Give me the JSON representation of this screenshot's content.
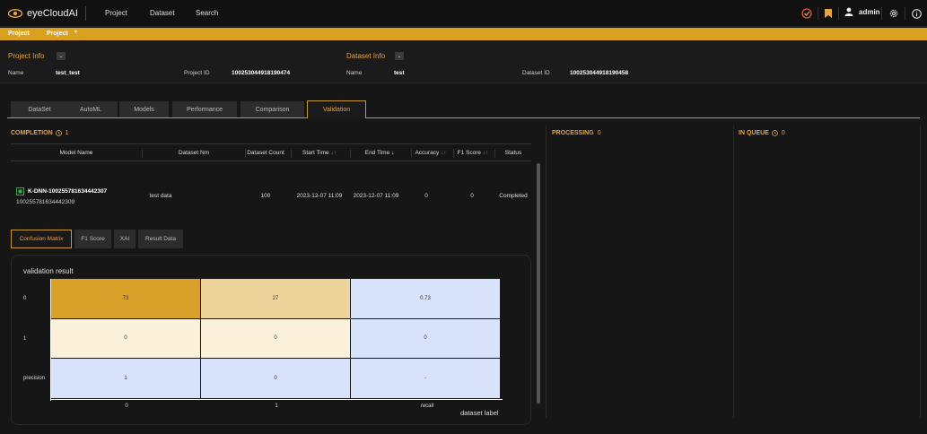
{
  "app": {
    "name": "eyeCloudAI"
  },
  "topnav": [
    "Project",
    "Dataset",
    "Search"
  ],
  "user": {
    "name": "admin"
  },
  "breadcrumb": {
    "root": "Project",
    "current": "Project"
  },
  "project_info": {
    "title": "Project Info",
    "name_label": "Name",
    "name": "test_test",
    "id_label": "Project ID",
    "id": "100253044918190474"
  },
  "dataset_info": {
    "title": "Dataset Info",
    "name_label": "Name",
    "name": "test",
    "id_label": "Dataset ID",
    "id": "100253044918190458"
  },
  "tabs": [
    "DataSet",
    "AutoML",
    "Models",
    "Performance",
    "Comparison",
    "Validation"
  ],
  "active_tab": "Validation",
  "completion": {
    "title": "COMPLETION",
    "count": "1"
  },
  "processing": {
    "title": "PROCESSING",
    "count": "0"
  },
  "in_queue": {
    "title": "IN QUEUE",
    "count": "0"
  },
  "table": {
    "headers": [
      "Model Name",
      "Dataset Nm",
      "Dataset Count",
      "Start Time",
      "End Time",
      "Accuracy",
      "F1 Score",
      "Status"
    ],
    "rows": [
      {
        "model_name": "K-DNN-100255781634442307",
        "model_id": "100255781634442309",
        "dataset_nm": "test data",
        "dataset_count": "100",
        "start_time": "2023-12-07 11:09",
        "end_time": "2023-12-07 11:09",
        "accuracy": "0",
        "f1_score": "0",
        "status": "Completed"
      }
    ]
  },
  "subtabs": [
    "Confusion Matrix",
    "F1 Score",
    "XAI",
    "Result Data"
  ],
  "active_subtab": "Confusion Matrix",
  "matrix": {
    "title": "validation result",
    "xlabel": "dataset label",
    "row_labels": [
      "0",
      "1",
      "precision"
    ],
    "col_labels": [
      "0",
      "1",
      "recall"
    ],
    "cells": [
      [
        "73",
        "27",
        "0.73"
      ],
      [
        "0",
        "0",
        "0"
      ],
      [
        "1",
        "0",
        "-"
      ]
    ],
    "colors": [
      [
        "#d9a12a",
        "#ecd49a",
        "#d8e3fb"
      ],
      [
        "#fbf0da",
        "#fbf0da",
        "#d8e3fb"
      ],
      [
        "#d8e3fb",
        "#d8e3fb",
        "#d8e3fb"
      ]
    ]
  },
  "colors": {
    "accent": "#e8a33c",
    "bar": "#daa11e",
    "background": "#161616"
  },
  "icons": [
    "eye-logo-icon",
    "check-circle-icon",
    "bookmark-icon",
    "user-icon",
    "gear-icon",
    "info-icon",
    "chevron-down-icon",
    "sort-icon",
    "clock-icon",
    "model-chip-icon"
  ]
}
